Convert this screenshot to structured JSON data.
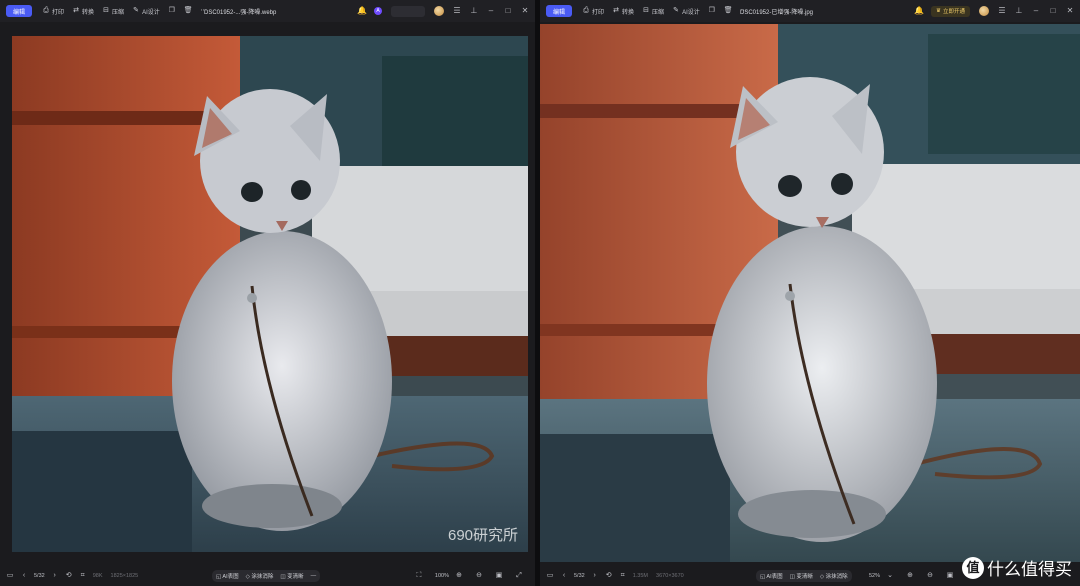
{
  "colors": {
    "accent": "#4a5bf5",
    "vip": "#f3cf6a"
  },
  "left": {
    "toolbar": {
      "edit_label": "编辑",
      "items": [
        {
          "icon": "printer-icon",
          "label": "打印"
        },
        {
          "icon": "convert-icon",
          "label": "转换"
        },
        {
          "icon": "compress-icon",
          "label": "压缩"
        },
        {
          "icon": "ai-design-icon",
          "label": "AI设计"
        }
      ]
    },
    "filename": "DSC01952-...强-降噪.webp",
    "bottom": {
      "page": "5/32",
      "size": "98K",
      "resolution": "1825×1825",
      "tools": [
        "AI表图",
        "涂抹消除",
        "变清晰"
      ],
      "zoom": "100%"
    },
    "watermark": "690研究所"
  },
  "right": {
    "toolbar": {
      "edit_label": "编辑",
      "items": [
        {
          "icon": "printer-icon",
          "label": "打印"
        },
        {
          "icon": "convert-icon",
          "label": "转换"
        },
        {
          "icon": "compress-icon",
          "label": "压缩"
        },
        {
          "icon": "ai-design-icon",
          "label": "AI设计"
        }
      ]
    },
    "filename": "DSC01952-已增强-降噪.jpg",
    "vip_label": "立即开通",
    "bottom": {
      "page": "5/32",
      "size": "1.35M",
      "resolution": "3670×3670",
      "tools": [
        "AI表图",
        "变清晰",
        "涂抹消除"
      ],
      "zoom": "52%"
    },
    "brand": "什么值得买"
  }
}
